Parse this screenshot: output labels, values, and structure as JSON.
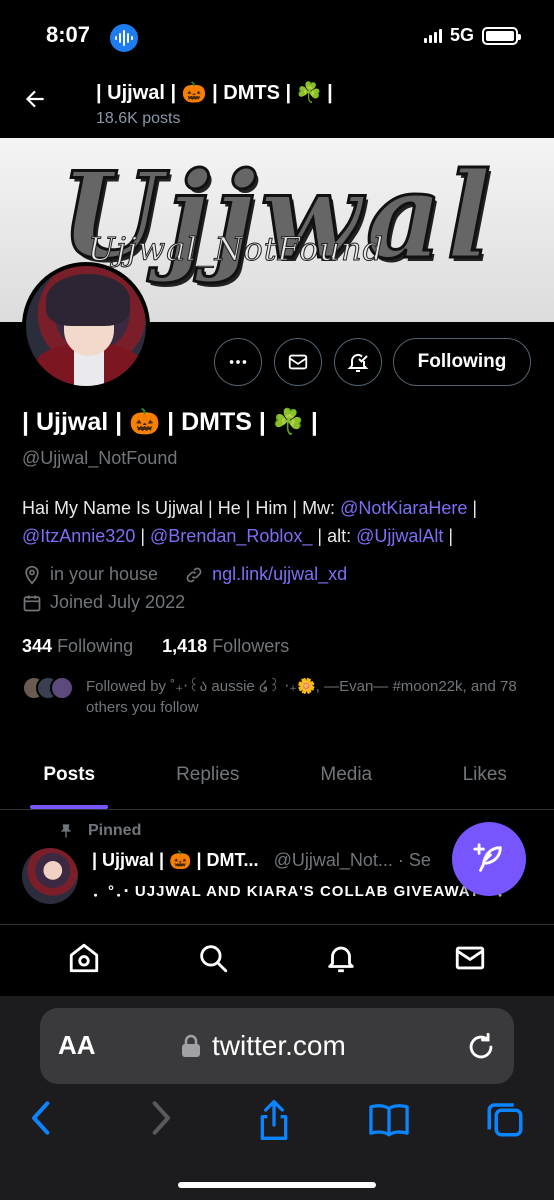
{
  "status": {
    "time": "8:07",
    "network": "5G"
  },
  "header": {
    "title": "| Ujjwal | 🎃 | DMTS | ☘️ |",
    "posts": "18.6K posts"
  },
  "banner": {
    "big": "Ujjwal",
    "small": "Ujjwal_NotFound"
  },
  "actions": {
    "follow_label": "Following"
  },
  "profile": {
    "name": "| Ujjwal | 🎃 | DMTS | ☘️ |",
    "handle": "@Ujjwal_NotFound",
    "bio_1": "Hai My Name Is Ujjwal | He | Him | Mw: ",
    "bio_link_1": "@NotKiaraHere",
    "bio_2": " |",
    "bio_link_2": "@ItzAnnie320",
    "bio_3": " | ",
    "bio_link_3": "@Brendan_Roblox_",
    "bio_4": " | alt: ",
    "bio_link_4": "@UjjwalAlt",
    "bio_5": " |",
    "location": "in your house",
    "website": "ngl.link/ujjwal_xd",
    "joined": "Joined July 2022",
    "following_count": "344",
    "following_label": "Following",
    "followers_count": "1,418",
    "followers_label": "Followers",
    "followed_by": "Followed by ˚₊‧꒰ა aussie ໒꒱ ‧₊🌼, —Evan— #moon22k, and 78 others you follow"
  },
  "tabs": [
    {
      "label": "Posts"
    },
    {
      "label": "Replies"
    },
    {
      "label": "Media"
    },
    {
      "label": "Likes"
    }
  ],
  "pinned_post": {
    "pinned_label": "Pinned",
    "author": "| Ujjwal | 🎃 | DMT...",
    "handle": "@Ujjwal_Not...",
    "sep": " · Se",
    "text": "．°．‧ UJJWAL AND KIARA'S COLLAB GIVEAWAY ‧ ．"
  },
  "browser": {
    "aa": "AA",
    "url": "twitter.com"
  },
  "colors": {
    "accent": "#7856ff",
    "link": "#7b6ff5",
    "muted": "#71767b"
  }
}
